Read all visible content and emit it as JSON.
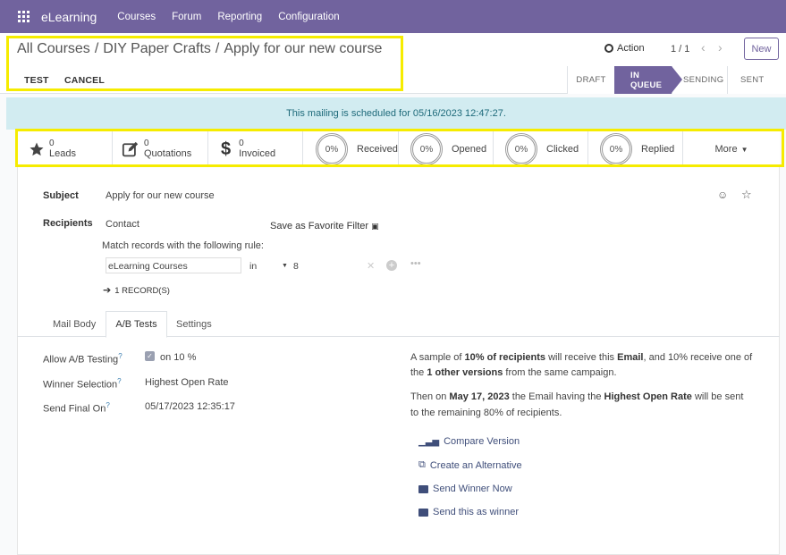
{
  "nav": {
    "brand": "eLearning",
    "items": [
      "Courses",
      "Forum",
      "Reporting",
      "Configuration"
    ]
  },
  "breadcrumb": [
    "All Courses",
    "DIY Paper Crafts",
    "Apply for our new course"
  ],
  "control": {
    "action_label": "Action",
    "pager": "1 / 1",
    "new_label": "New",
    "test_label": "TEST",
    "cancel_label": "CANCEL"
  },
  "stages": [
    {
      "label": "DRAFT",
      "active": false
    },
    {
      "label": "IN QUEUE",
      "active": true
    },
    {
      "label": "SENDING",
      "active": false
    },
    {
      "label": "SENT",
      "active": false
    }
  ],
  "banner": "This mailing is scheduled for 05/16/2023 12:47:27.",
  "stats": {
    "leads": {
      "value": "0",
      "label": "Leads"
    },
    "quotations": {
      "value": "0",
      "label": "Quotations"
    },
    "invoiced": {
      "value": "0",
      "label": "Invoiced"
    },
    "received": {
      "value": "0%",
      "label": "Received"
    },
    "opened": {
      "value": "0%",
      "label": "Opened"
    },
    "clicked": {
      "value": "0%",
      "label": "Clicked"
    },
    "replied": {
      "value": "0%",
      "label": "Replied"
    },
    "more_label": "More"
  },
  "form": {
    "subject_label": "Subject",
    "subject_value": "Apply for our new course",
    "recipients_label": "Recipients",
    "recipients_value": "Contact",
    "favorite_filter": "Save as Favorite Filter",
    "match_text": "Match records with the following rule:",
    "rule_field": "eLearning Courses",
    "rule_operator": "in",
    "rule_value": "8",
    "records": "1 RECORD(S)"
  },
  "tabs": [
    "Mail Body",
    "A/B Tests",
    "Settings"
  ],
  "ab": {
    "allow_label": "Allow A/B Testing",
    "allow_value": "on 10 %",
    "winner_label": "Winner Selection",
    "winner_value": "Highest Open Rate",
    "send_final_label": "Send Final On",
    "send_final_value": "05/17/2023 12:35:17",
    "d1_a": "A sample of ",
    "d1_b": "10% of recipients",
    "d1_c": " will receive this ",
    "d1_d": "Email",
    "d1_e": ", and 10% receive one of",
    "d2_a": "the ",
    "d2_b": "1 other versions",
    "d2_c": " from the same campaign.",
    "d3_a": "Then on ",
    "d3_b": "May 17, 2023",
    "d3_c": " the Email having the ",
    "d3_d": "Highest Open Rate",
    "d3_e": " will be sent",
    "d4": "to the remaining 80% of recipients.",
    "links": {
      "compare": "Compare Version",
      "alternative": "Create an Alternative",
      "send_winner": "Send Winner Now",
      "send_as_winner": "Send this as winner"
    }
  },
  "colors": {
    "brand": "#71639e",
    "banner_bg": "#d2ecf1",
    "highlight": "#f6ec00"
  }
}
